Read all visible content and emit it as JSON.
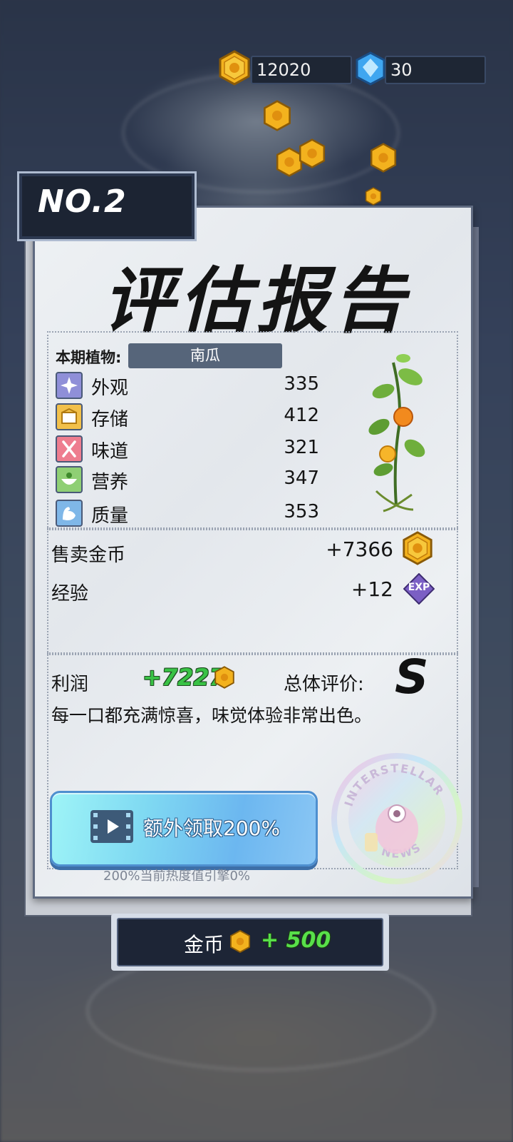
{
  "currency": {
    "gold": "12020",
    "gems": "30"
  },
  "report": {
    "tag": "NO.2",
    "title": "评估报告",
    "plant_label": "本期植物:",
    "plant_name": "南瓜",
    "stats": [
      {
        "label": "外观",
        "value": "335",
        "icon": "sparkle-icon",
        "color": "#8f8fd8"
      },
      {
        "label": "存储",
        "value": "412",
        "icon": "box-icon",
        "color": "#f2c04a"
      },
      {
        "label": "味道",
        "value": "321",
        "icon": "utensils-icon",
        "color": "#ee7d8f"
      },
      {
        "label": "营养",
        "value": "347",
        "icon": "nutrition-bowl-icon",
        "color": "#8fcf74"
      },
      {
        "label": "质量",
        "value": "353",
        "icon": "muscle-icon",
        "color": "#7fb7e8"
      }
    ],
    "sell_label": "售卖金币",
    "sell_value": "+7366",
    "exp_label": "经验",
    "exp_value": "+12",
    "exp_badge": "EXP",
    "profit_label": "利润",
    "profit_value": "+7227",
    "rating_label": "总体评价:",
    "grade": "S",
    "comment": "每一口都充满惊喜，味觉体验非常出色。",
    "bonus_button": "额外领取200%",
    "heat_note": "200%当前热度值引擎0%",
    "stamp_text_top": "INTERSTELLAR",
    "stamp_text_bottom": "NEWS"
  },
  "bottom": {
    "label": "金币",
    "value": "+ 500"
  },
  "colors": {
    "gold": "#f3b21e",
    "profit_green": "#39c245",
    "bonus_cyan": "#7fd9f2"
  }
}
